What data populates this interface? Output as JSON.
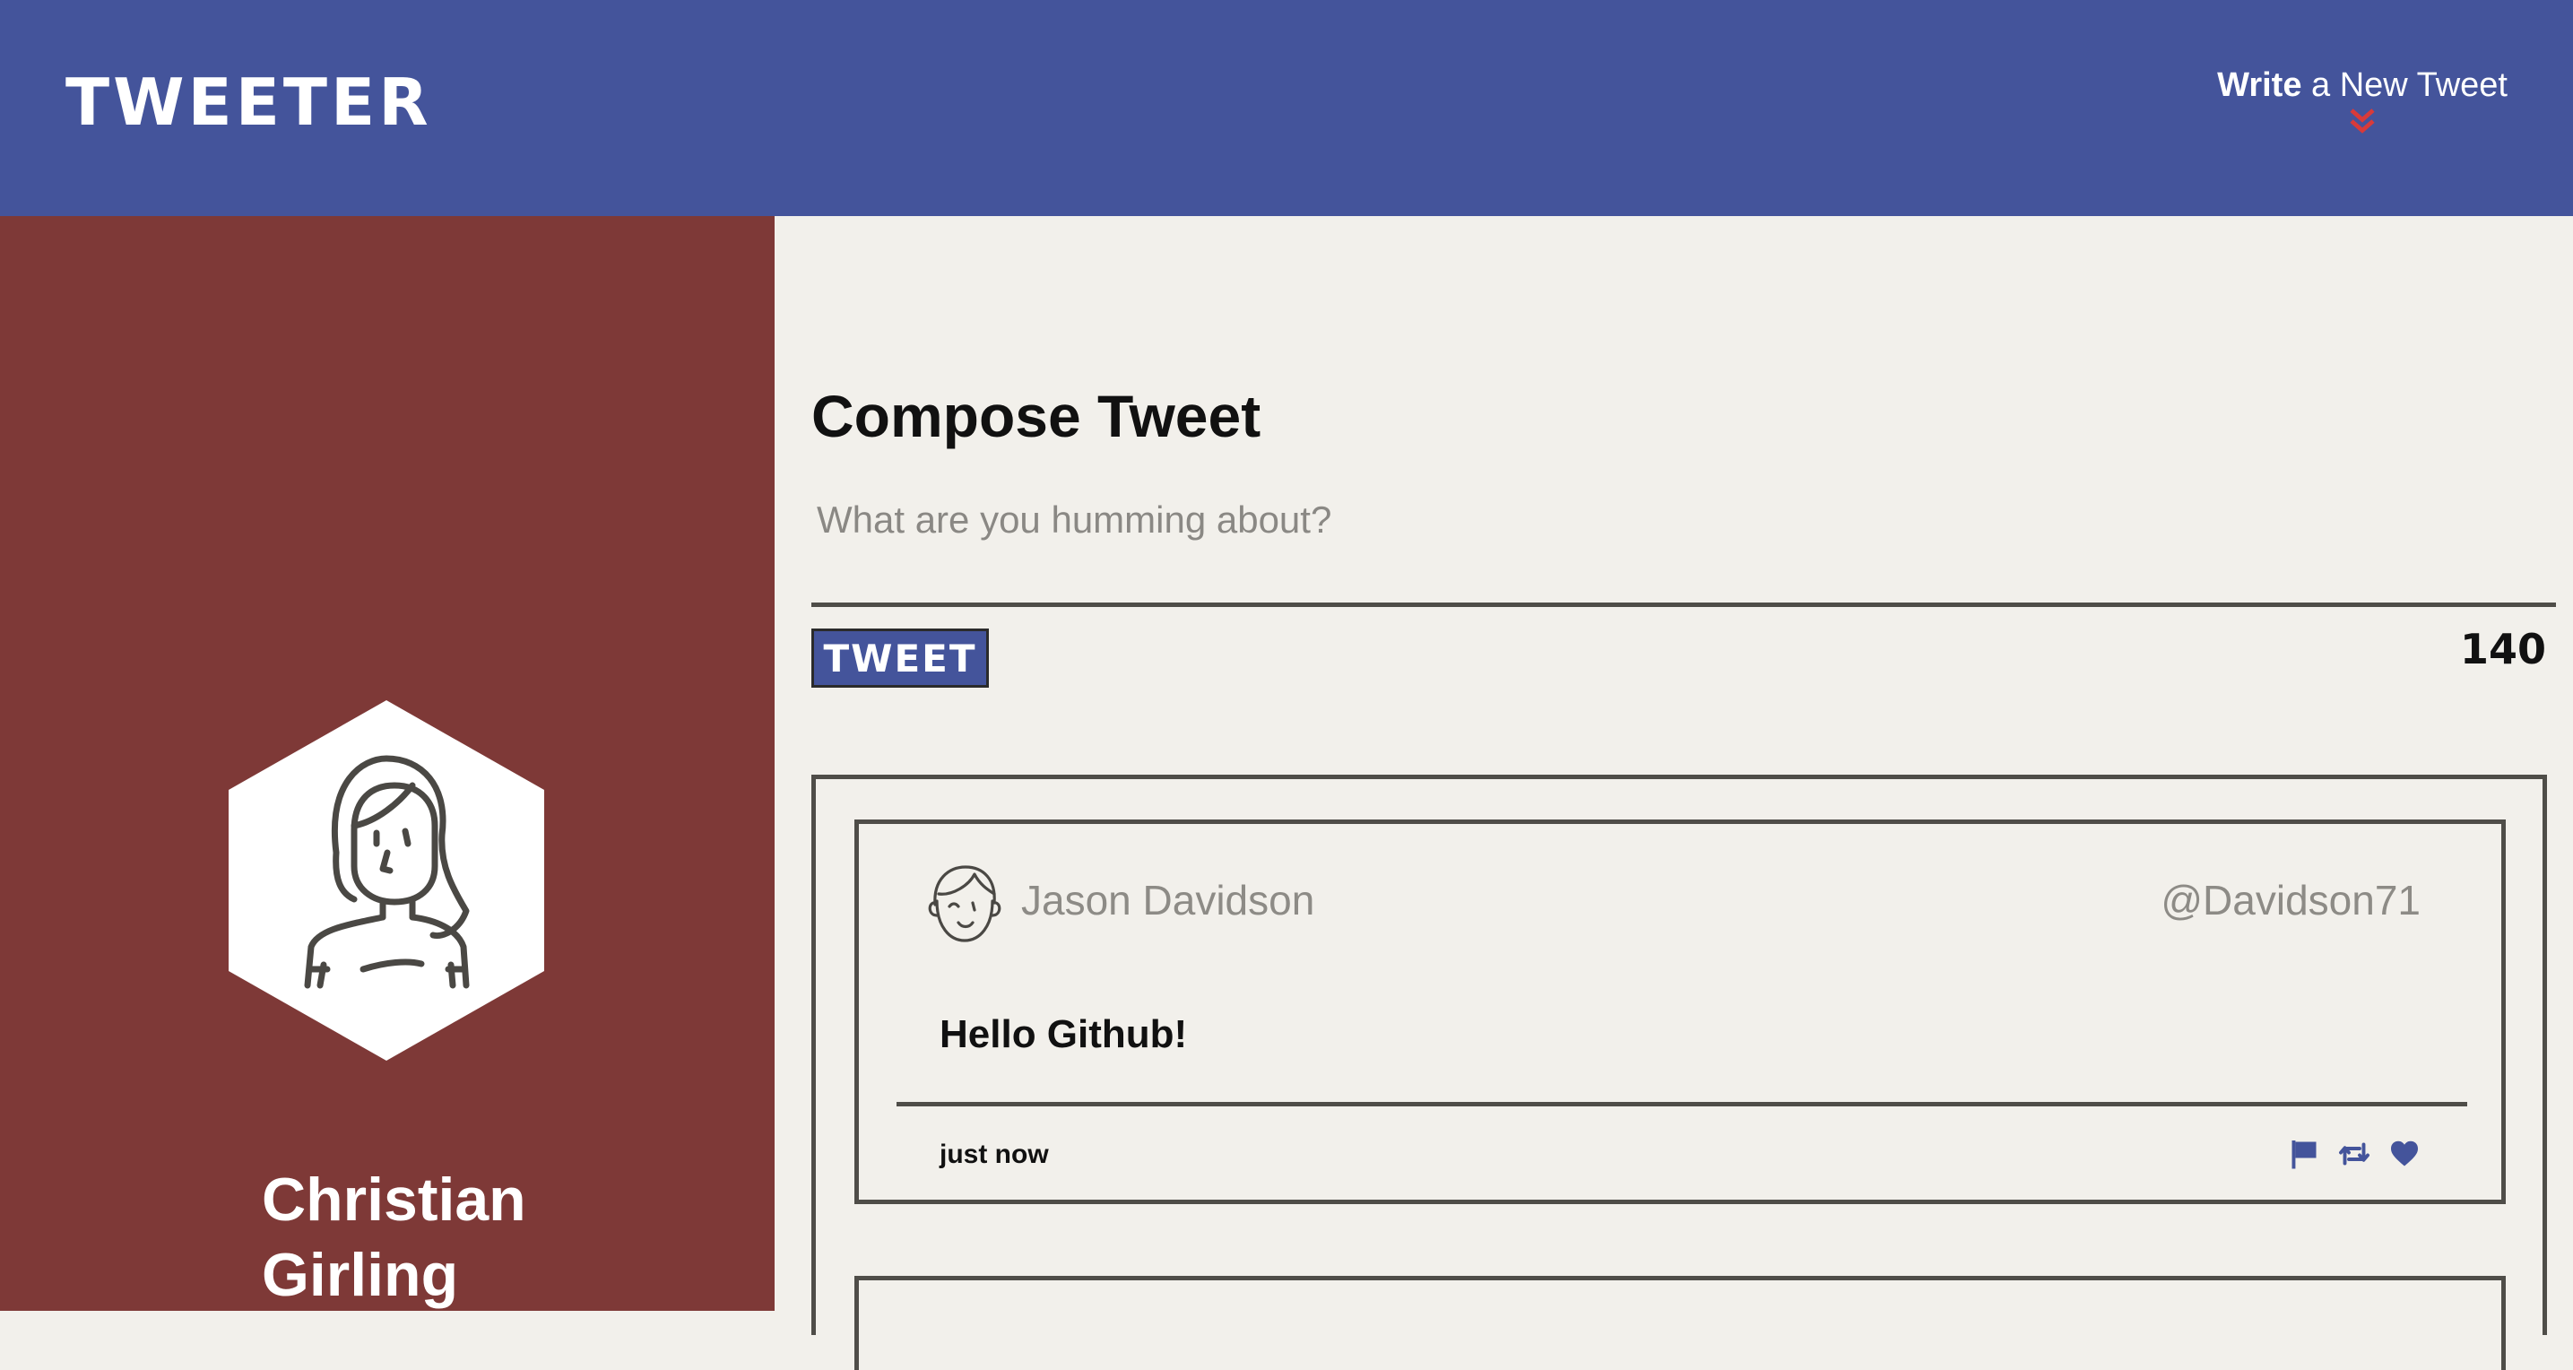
{
  "nav": {
    "brand": "TWEETER",
    "write_strong": "Write",
    "write_rest": " a New Tweet",
    "chevron_icon": "double-chevron-down-icon"
  },
  "sidebar": {
    "avatar_icon": "woman-avatar-icon",
    "user_name": "Christian Girling"
  },
  "compose": {
    "title": "Compose Tweet",
    "placeholder": "What are you humming about?",
    "value": "",
    "button_label": "TWEET",
    "counter": "140"
  },
  "tweets": [
    {
      "avatar_icon": "winking-man-avatar-icon",
      "author": "Jason Davidson",
      "handle": "@Davidson71",
      "body": "Hello Github!",
      "time": "just now",
      "actions": [
        "flag-icon",
        "retweet-icon",
        "heart-icon"
      ]
    }
  ],
  "colors": {
    "nav_bg": "#44549b",
    "sidebar_bg": "#7e3937",
    "main_bg": "#f2f0eb",
    "accent_red": "#c0392b",
    "icon_blue": "#44549b"
  }
}
